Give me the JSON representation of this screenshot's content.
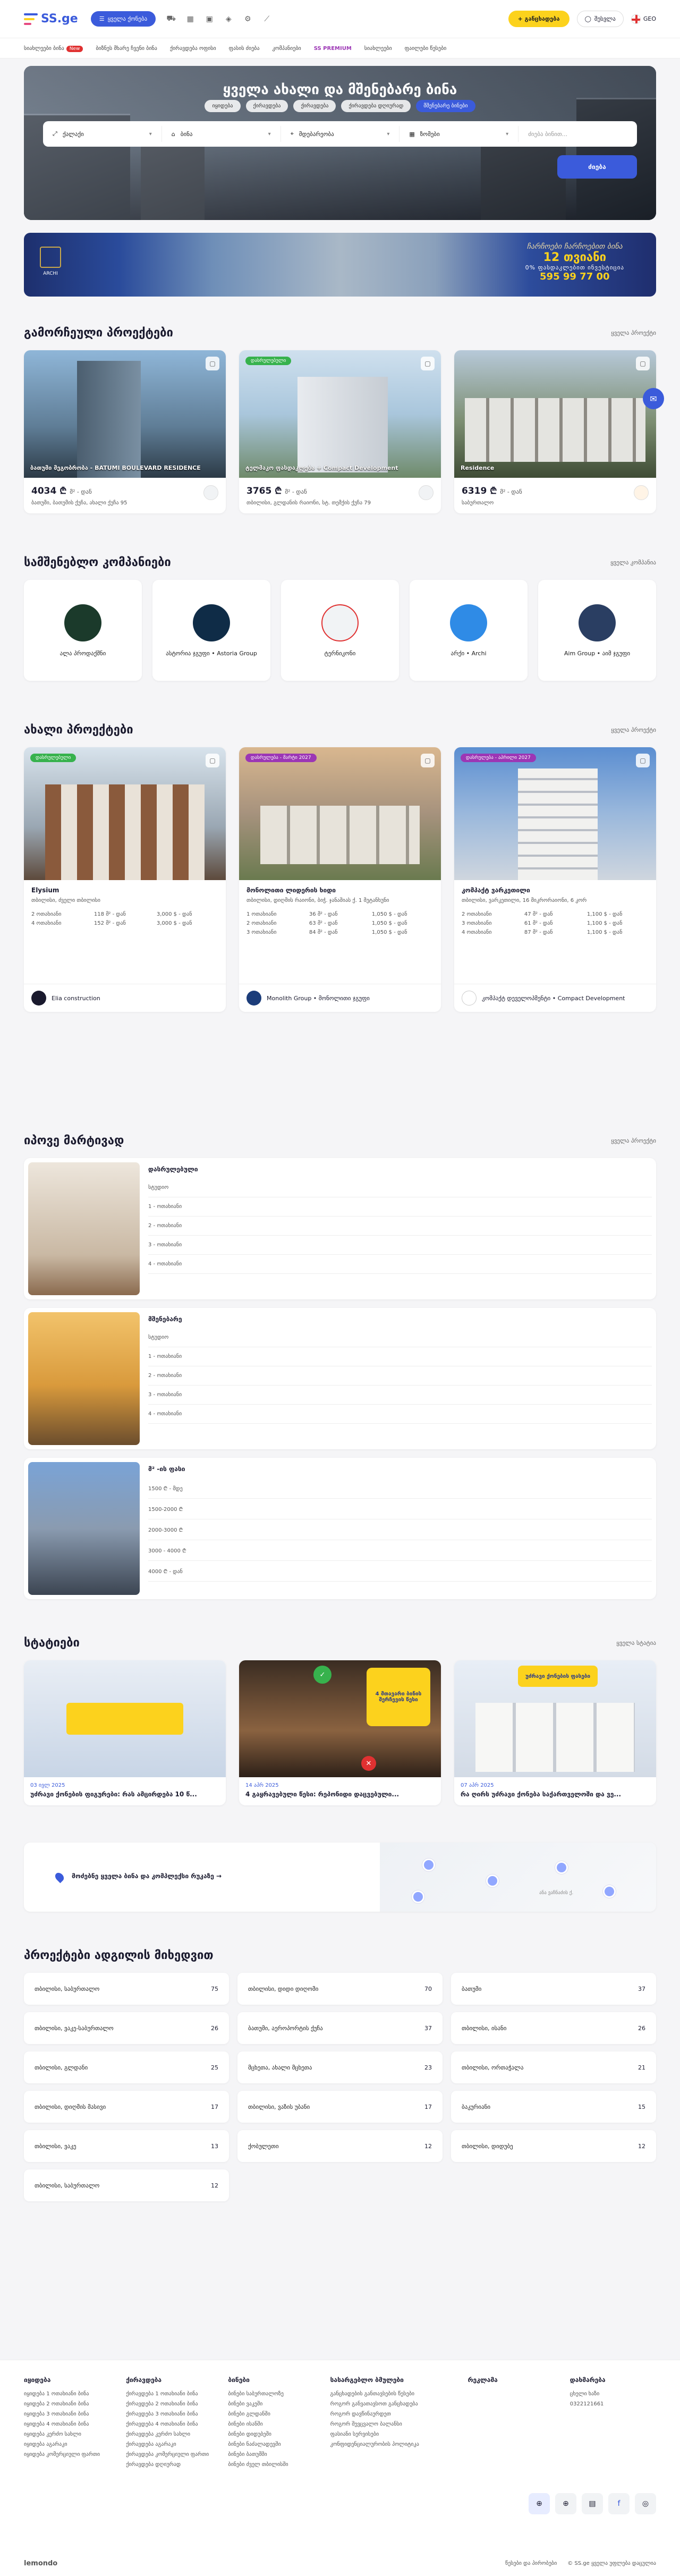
{
  "header": {
    "logo": "SS.ge",
    "category_button": "ყველა ქონება",
    "add_button": "+ განცხადება",
    "login": "შესვლა",
    "lang": "GEO"
  },
  "subnav": {
    "items": [
      "სიახლეები ბინა",
      "ბიზნეს მხარე ჩვენი ბინა",
      "ქირავდება ოფისი",
      "ფასის ძიება",
      "კომპანიები",
      "SS PREMIUM",
      "სიახლეები",
      "ფაილები წესები"
    ],
    "new_badge": "New"
  },
  "hero": {
    "title": "ყველა ახალი და მშენებარე ბინა",
    "tabs": [
      "იყიდება",
      "ქირავდება",
      "ქირავდება",
      "ქირავდება დღიურად",
      "მშენებარე ბინები"
    ],
    "active_tab": 4,
    "fields": [
      {
        "label": "ქალაქი",
        "icon": "expand-icon"
      },
      {
        "label": "ბინა",
        "icon": "home-icon"
      },
      {
        "label": "მდებარეობა",
        "icon": "pin-icon"
      },
      {
        "label": "ზომები",
        "icon": "grid-icon"
      }
    ],
    "search_placeholder": "ძიება ბინით...",
    "search_button": "ძიება"
  },
  "banner": {
    "brand": "ARCHI",
    "line1": "ჩარჩოები ჩარჩოებით ბინა",
    "line2": "12 თვიანი",
    "line3": "0% ფასდაკლებით ინვესტიცია",
    "phone": "595 99 77 00"
  },
  "featured": {
    "title": "გამორჩეული პროექტები",
    "link": "ყველა პროექტი",
    "cards": [
      {
        "overlay": "ბათუმი მეგობრობა - BATUMI BOULEVARD RESIDENCE",
        "price": "4034 ₾",
        "unit": "მ² - დან",
        "addr": "ბათუმი, ბათუმის ქუჩა, ახალი ქუჩა 95",
        "tag": ""
      },
      {
        "overlay": "ტელმაკო ფასდაკლება + Compact Development",
        "price": "3765 ₾",
        "unit": "მ² - დან",
        "addr": "თბილისი, გლდანის რაიონი, სტ. თემქის ქუჩა 79",
        "tag": "დასრულებული"
      },
      {
        "overlay": "Residence",
        "price": "6319 ₾",
        "unit": "მ² - დან",
        "addr": "საბურთალო",
        "tag": ""
      }
    ]
  },
  "companies": {
    "title": "სამშენებლო კომპანიები",
    "link": "ყველა კომპანია",
    "items": [
      {
        "name": "ალა პროდაქშნი",
        "color": "#1b3a2b"
      },
      {
        "name": "ასტორია ჯგუფი • Astoria Group",
        "color": "#0f2c47"
      },
      {
        "name": "ტერნიკონი",
        "color": "#f1f3f5"
      },
      {
        "name": "არქი • Archi",
        "color": "#2f8be6"
      },
      {
        "name": "Aim Group • აიმ ჯგუფი",
        "color": "#2a3e62"
      }
    ]
  },
  "new_projects": {
    "title": "ახალი პროექტები",
    "link": "ყველა პროექტი",
    "cards": [
      {
        "tag": "დასრულებული",
        "title": "Elysium",
        "addr": "თბილისი, ძველი თბილისი",
        "rows": [
          [
            "2 ოთახიანი",
            "118 მ² - დან",
            "3,000 $ - დან"
          ],
          [
            "4 ოთახიანი",
            "152 მ² - დან",
            "3,000 $ - დან"
          ]
        ],
        "dev": "Elia construction"
      },
      {
        "tag": "დასრულება - მარტი 2027",
        "title": "მონოლითი ლიდერის ხიდი",
        "addr": "თბილისი, დიღმის რაიონი, ბიჭ. ჯანაშიას ქ. 1 მეტანხუნი",
        "rows": [
          [
            "1 ოთახიანი",
            "36 მ² - დან",
            "1,050 $ - დან"
          ],
          [
            "2 ოთახიანი",
            "63 მ² - დან",
            "1,050 $ - დან"
          ],
          [
            "3 ოთახიანი",
            "84 მ² - დან",
            "1,050 $ - დან"
          ]
        ],
        "dev": "Monolith Group • მონოლითი ჯგუფი"
      },
      {
        "tag": "დასრულება - აპრილი 2027",
        "title": "კომპაქტ ვარკეთილი",
        "addr": "თბილისი, ვარკეთილი, 16 მიკრორაიონი, 6 კორ",
        "rows": [
          [
            "2 ოთახიანი",
            "47 მ² - დან",
            "1,100 $ - დან"
          ],
          [
            "3 ოთახიანი",
            "61 მ² - დან",
            "1,100 $ - დან"
          ],
          [
            "4 ოთახიანი",
            "87 მ² - დან",
            "1,100 $ - დან"
          ]
        ],
        "dev": "კომპაქტ დეველოპმენტი • Compact Development"
      }
    ]
  },
  "market": {
    "title": "იპოვე მარტივად",
    "link": "ყველა პროექტი",
    "cards": [
      {
        "title": "დასრულებული",
        "rows": [
          "სტუდიო",
          "1 - ოთახიანი",
          "2 - ოთახიანი",
          "3 - ოთახიანი",
          "4 - ოთახიანი"
        ]
      },
      {
        "title": "მშენებარე",
        "rows": [
          "სტუდიო",
          "1 - ოთახიანი",
          "2 - ოთახიანი",
          "3 - ოთახიანი",
          "4 - ოთახიანი"
        ]
      },
      {
        "title": "მ² -ის ფასი",
        "rows": [
          "1500 ₾ - მდე",
          "1500-2000 ₾",
          "2000-3000 ₾",
          "3000 - 4000 ₾",
          "4000 ₾ - დან"
        ]
      }
    ]
  },
  "articles": {
    "title": "სტატიები",
    "link": "ყველა სტატია",
    "cards": [
      {
        "date": "03 ივლ 2025",
        "title": "უძრავი ქონების ფიგურები: რას ამცირდება 10 წ..."
      },
      {
        "date": "14 აპრ 2025",
        "title": "4 გაყრავებული წესი: რეპონიდი დაცვებული..."
      },
      {
        "date": "07 აპრ 2025",
        "title": "რა ღირს უძრავი ქონება საქართველოში და ვე..."
      }
    ],
    "card2_text": "4 მთავარი ბინის შერჩევის წესი",
    "card3_text": "უძრავი ქონების ფასები"
  },
  "map": {
    "cta": "მოძებნე ყველა ბინა და კომპლექსი რუკაზე  →",
    "street": "ანა ვაჩნაძის ქ."
  },
  "locations": {
    "title": "პროექტები ადგილის მიხედვით",
    "items": [
      [
        "თბილისი, საბურთალო",
        "75"
      ],
      [
        "თბილისი, დიდი დიღომი",
        "70"
      ],
      [
        "ბათუმი",
        "37"
      ],
      [
        "თბილისი, ვაკე-საბურთალო",
        "26"
      ],
      [
        "ბათუმი, აეროპორტის ქუჩა",
        "37"
      ],
      [
        "თბილისი, ისანი",
        "26"
      ],
      [
        "თბილისი, გლდანი",
        "25"
      ],
      [
        "მცხეთა, ახალი მცხეთა",
        "23"
      ],
      [
        "თბილისი, ორთაჭალა",
        "21"
      ],
      [
        "თბილისი, დიღმის მასივი",
        "17"
      ],
      [
        "თბილისი, ვაზის უბანი",
        "17"
      ],
      [
        "ბაკურიანი",
        "15"
      ],
      [
        "თბილისი, ვაკე",
        "13"
      ],
      [
        "ქობულეთი",
        "12"
      ],
      [
        "თბილისი, დიდუბე",
        "12"
      ],
      [
        "თბილისი, საბურთალო",
        "12"
      ]
    ]
  },
  "footer": {
    "cols": [
      {
        "h": "იყიდება",
        "items": [
          "იყიდება 1 ოთახიანი ბინა",
          "იყიდება 2 ოთახიანი ბინა",
          "იყიდება 3 ოთახიანი ბინა",
          "იყიდება 4 ოთახიანი ბინა",
          "იყიდება კერძო სახლი",
          "იყიდება აგარაკი",
          "იყიდება კომერციული ფართი"
        ]
      },
      {
        "h": "ქირავდება",
        "items": [
          "ქირავდება 1 ოთახიანი ბინა",
          "ქირავდება 2 ოთახიანი ბინა",
          "ქირავდება 3 ოთახიანი ბინა",
          "ქირავდება 4 ოთახიანი ბინა",
          "ქირავდება კერძო სახლი",
          "ქირავდება აგარაკი",
          "ქირავდება კომერციული ფართი",
          "ქირავდება დღიურად"
        ]
      },
      {
        "h": "ბინები",
        "items": [
          "ბინები საბურთალოზე",
          "ბინები ვაკეში",
          "ბინები გლდანში",
          "ბინები ისანში",
          "ბინები დიდუბეში",
          "ბინები ნაძალადევში",
          "ბინები ბათუმში",
          "ბინები ძველ თბილისში"
        ]
      },
      {
        "h": "სასარგებლო ბმულები",
        "items": [
          "განცხადების განთავსების წესები",
          "როგორ განვათავსოთ განცხადება",
          "როგორ დავწინაურდეთ",
          "როგორ შევცვალო ბალანსი",
          "ფასიანი სერვისები",
          "კონფიდენციალურობის პოლიტიკა"
        ]
      },
      {
        "h": "რეკლამა",
        "items": []
      },
      {
        "h": "დახმარება",
        "items": [
          "ცხელი ხაზი",
          "0322121661"
        ]
      }
    ],
    "bottom_left": "lemondo",
    "bottom_right": "© SS.ge ყველა უფლება დაცულია",
    "bottom_mid": "წესები და პირობები"
  }
}
